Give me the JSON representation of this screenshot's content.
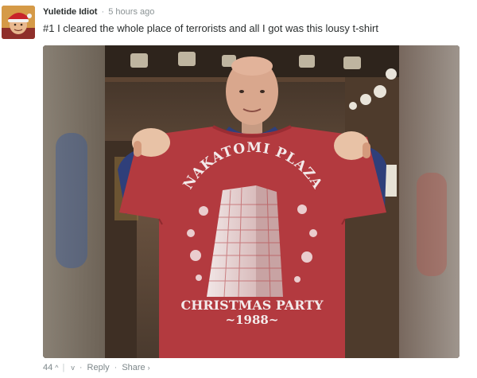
{
  "comment": {
    "author": "Yuletide Idiot",
    "separator": "·",
    "timestamp": "5 hours ago",
    "text": "#1 I cleared the whole place of terrorists and all I got was this lousy t-shirt"
  },
  "shirt": {
    "arc_text": "NAKATOMI PLAZA",
    "line1": "CHRISTMAS PARTY",
    "line2": "~1988~"
  },
  "footer": {
    "votes": "44",
    "upvote_icon": "^",
    "divider": "|",
    "downvote_icon": "v",
    "dot1": "·",
    "reply_label": "Reply",
    "dot2": "·",
    "share_label": "Share",
    "share_icon": "›"
  },
  "colors": {
    "shirt_red": "#b33a3f",
    "author_text": "#2a2e2e",
    "meta_text": "#7d878a"
  }
}
